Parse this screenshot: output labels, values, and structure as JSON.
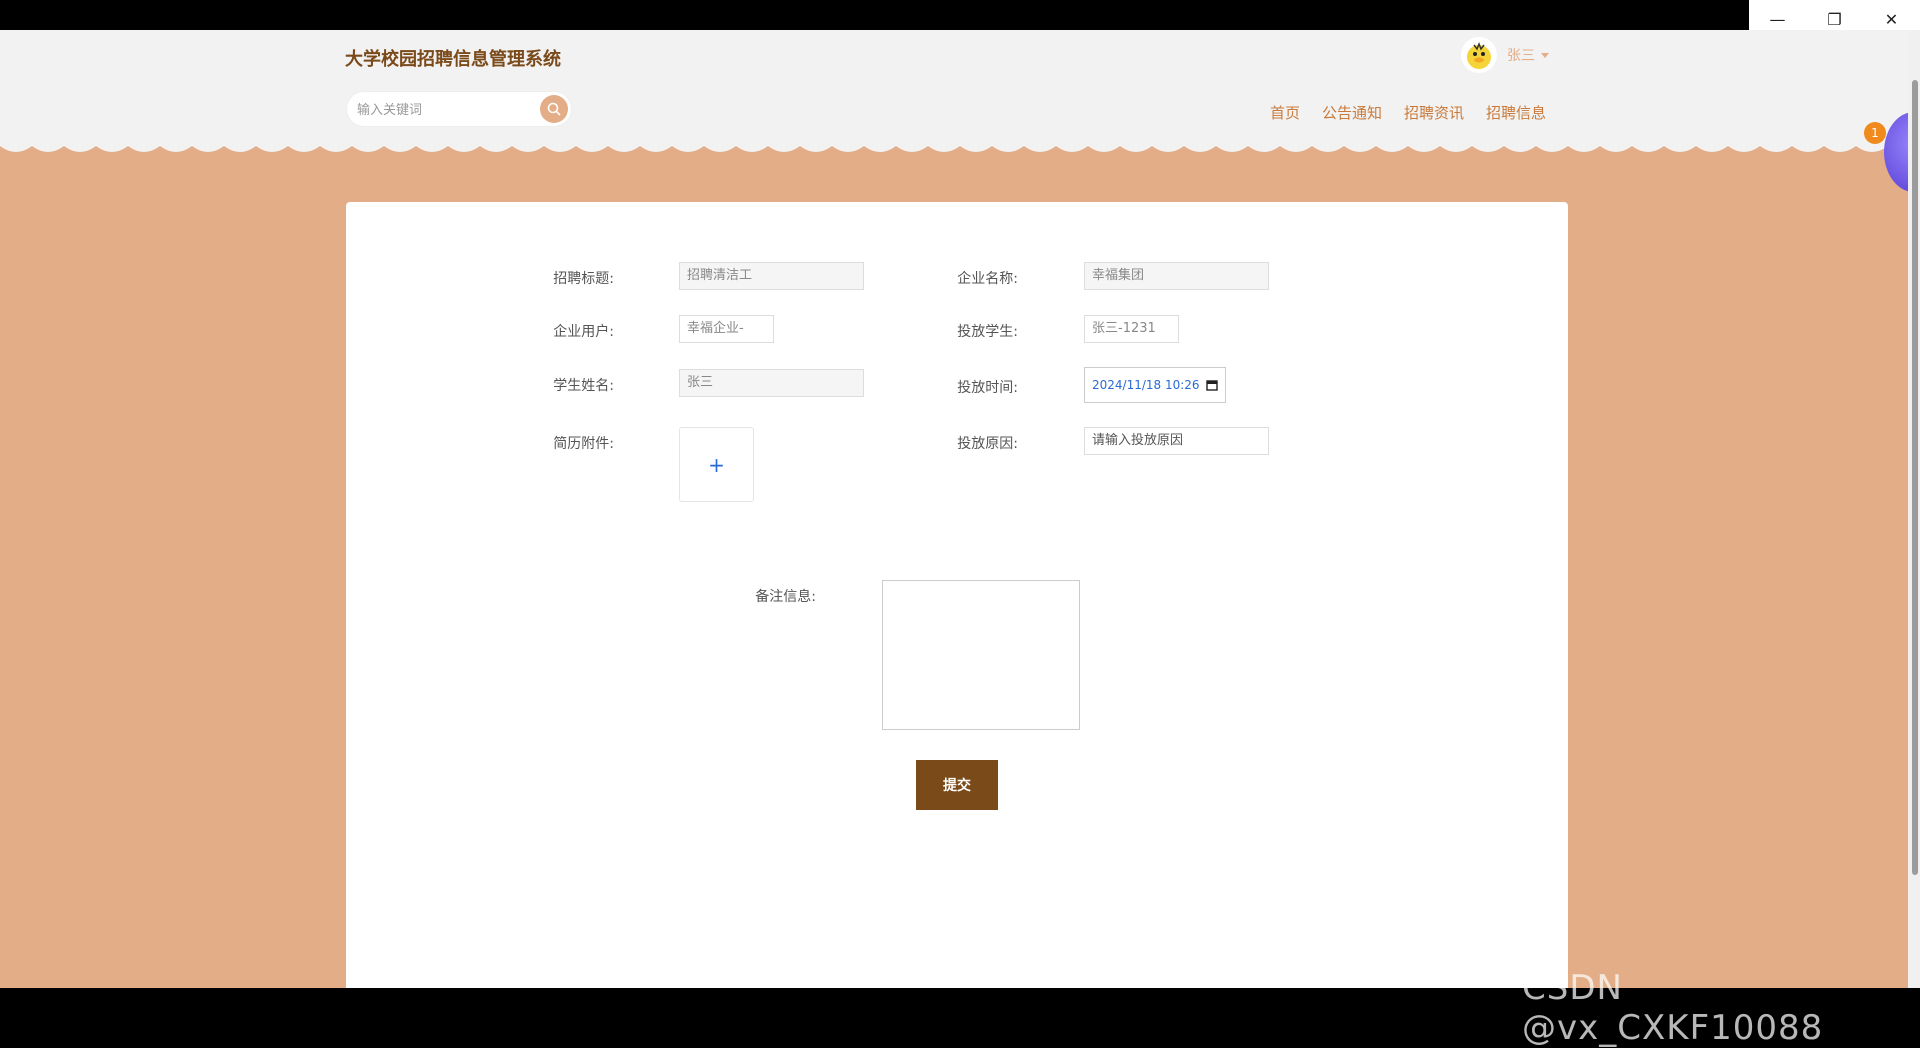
{
  "window": {
    "controls": [
      "—",
      "❐",
      "✕"
    ]
  },
  "header": {
    "title": "大学校园招聘信息管理系统",
    "search_placeholder": "输入关键词",
    "user_name": "张三",
    "nav": [
      "首页",
      "公告通知",
      "招聘资讯",
      "招聘信息"
    ],
    "badge_count": "1"
  },
  "form": {
    "recruit_title_label": "招聘标题:",
    "recruit_title_value": "招聘清洁工",
    "company_name_label": "企业名称:",
    "company_name_value": "幸福集团",
    "company_user_label": "企业用户:",
    "company_user_value": "幸福企业-",
    "applicant_label": "投放学生:",
    "applicant_value": "张三-1231",
    "student_name_label": "学生姓名:",
    "student_name_value": "张三",
    "submit_time_label": "投放时间:",
    "submit_time_value": "2024/11/18 10:26",
    "resume_label": "简历附件:",
    "reason_label": "投放原因:",
    "reason_placeholder": "请输入投放原因",
    "remark_label": "备注信息:",
    "submit_label": "提交"
  },
  "watermark": "CSDN @vx_CXKF10088"
}
